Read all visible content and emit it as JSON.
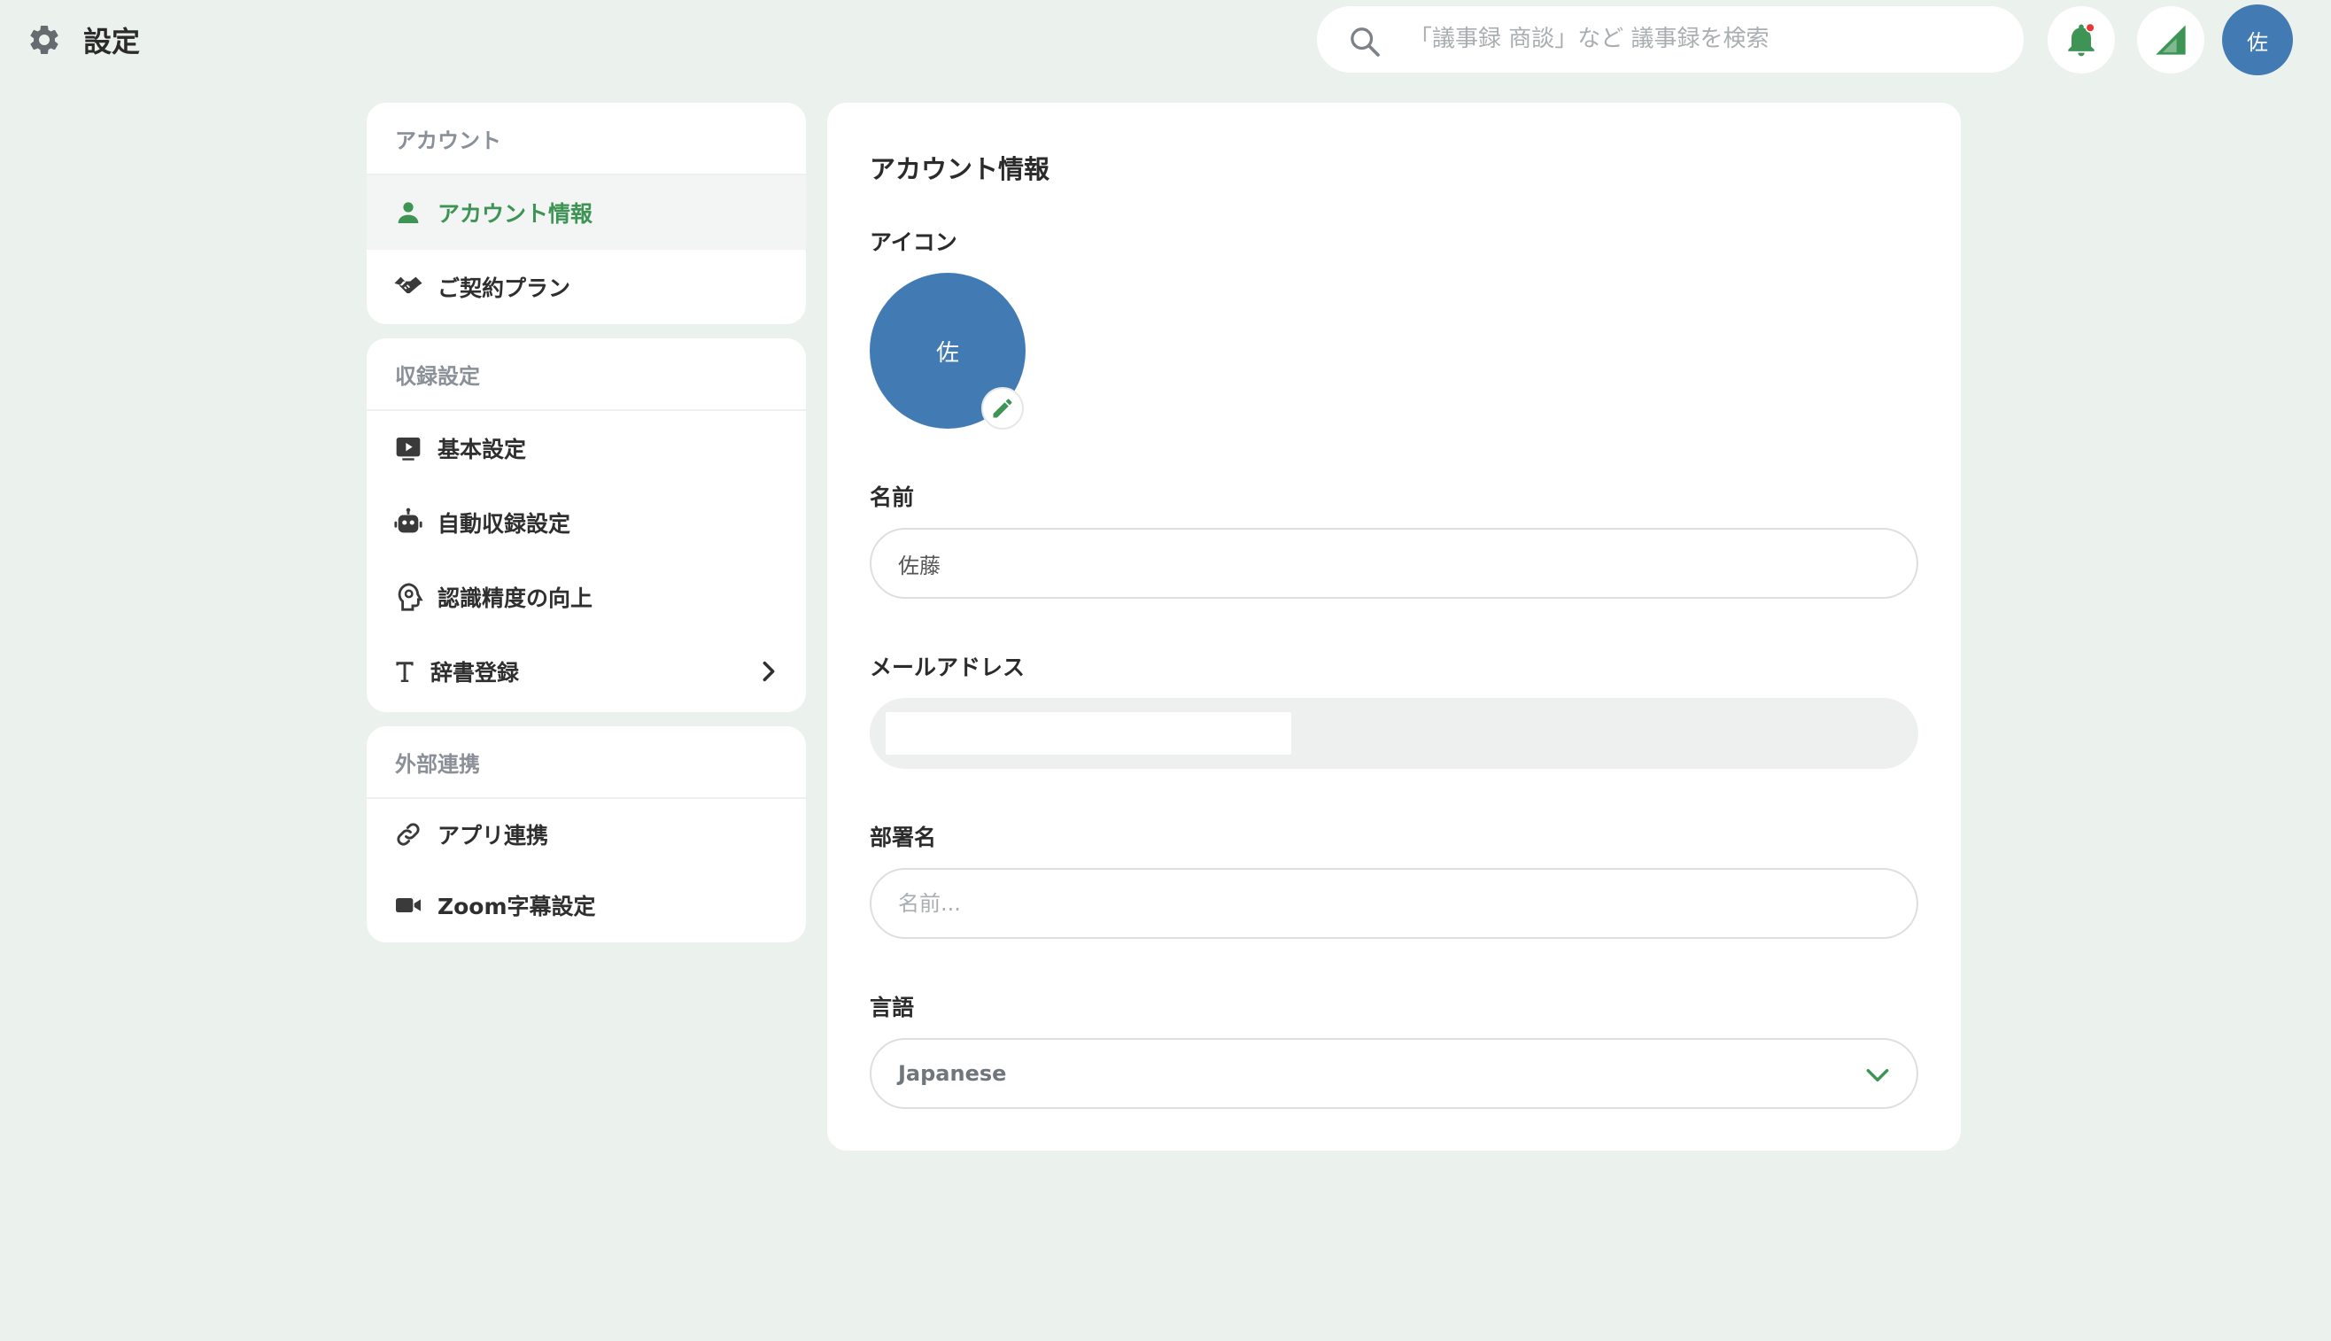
{
  "header": {
    "title": "設定",
    "search_placeholder": "「議事録 商談」など 議事録を検索",
    "avatar_initial": "佐"
  },
  "sidebar": {
    "sections": [
      {
        "title": "アカウント",
        "items": [
          {
            "label": "アカウント情報",
            "icon": "user-icon",
            "active": true
          },
          {
            "label": "ご契約プラン",
            "icon": "handshake-icon"
          }
        ]
      },
      {
        "title": "収録設定",
        "items": [
          {
            "label": "基本設定",
            "icon": "play-screen-icon"
          },
          {
            "label": "自動収録設定",
            "icon": "robot-icon"
          },
          {
            "label": "認識精度の向上",
            "icon": "brain-gear-icon"
          },
          {
            "label": "辞書登録",
            "icon": "text-icon",
            "has_chevron": true
          }
        ]
      },
      {
        "title": "外部連携",
        "items": [
          {
            "label": "アプリ連携",
            "icon": "link-icon"
          },
          {
            "label": "Zoom字幕設定",
            "icon": "video-camera-icon"
          }
        ]
      }
    ]
  },
  "main": {
    "title": "アカウント情報",
    "icon_label": "アイコン",
    "avatar_initial": "佐",
    "name_label": "名前",
    "name_value": "佐藤",
    "email_label": "メールアドレス",
    "department_label": "部署名",
    "department_placeholder": "名前...",
    "language_label": "言語",
    "language_value": "Japanese"
  },
  "colors": {
    "accent_green": "#3d9455",
    "avatar_blue": "#427bb3",
    "background": "#ebf1ed",
    "notification_dot": "#e53935"
  }
}
